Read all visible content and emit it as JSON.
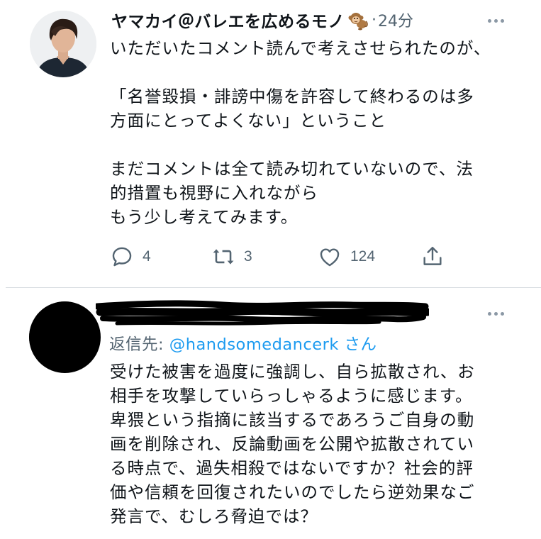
{
  "tweet1": {
    "display_name": "ヤマカイ＠バレエを広めるモノ",
    "name_emoji": "monkey-emoji",
    "separator": "·",
    "time": "24分",
    "text": "いただいたコメント読んで考えさせられたのが、\n\n「名誉毀損・誹謗中傷を許容して終わるのは多\n方面にとってよくない」ということ\n\nまだコメントは全て読み切れていないので、法\n的措置も視野に入れながら\nもう少し考えてみます。",
    "reply_count": "4",
    "retweet_count": "3",
    "like_count": "124",
    "icons": [
      "reply-icon",
      "retweet-icon",
      "like-icon",
      "share-icon"
    ]
  },
  "tweet2": {
    "reply_to_prefix": "返信先: ",
    "reply_to_handle": "@handsomedancerk",
    "reply_to_suffix": " さん",
    "text": "受けた被害を過度に強調し、自ら拡散され、お\n相手を攻撃していらっしゃるように感じます。\n卑猥という指摘に該当するであろうご自身の動\n画を削除され、反論動画を公開や拡散されてい\nる時点で、過失相殺ではないですか？社会的評\n価や信頼を回復されたいのでしたら逆効果なご\n発言で、むしろ脅迫では？"
  },
  "colors": {
    "text_primary": "#0f1419",
    "text_secondary": "#536471",
    "link": "#1d9bf0",
    "divider": "#d8dde2",
    "background": "#ffffff"
  }
}
